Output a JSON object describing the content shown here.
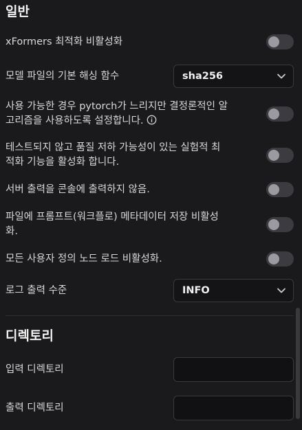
{
  "general": {
    "title": "일반",
    "xformers_label": "xFormers 최적화 비활성화",
    "hash_label": "모델 파일의 기본 해싱 함수",
    "hash_value": "sha256",
    "deterministic_label_1": "사용 가능한 경우 pytorch가 느리지만 결정론적인 알",
    "deterministic_label_2": "고리즘을 사용하도록 설정합니다.",
    "experimental_label_1": "테스트되지 않고 품질 저하 가능성이 있는 실험적 최",
    "experimental_label_2": "적화 기능을 활성화 합니다.",
    "console_label": "서버 출력을 콘솔에 출력하지 않음.",
    "metadata_label_1": "파일에 프롬프트(워크플로) 메타데이터 저장 비활성",
    "metadata_label_2": "화.",
    "custom_nodes_label": "모든 사용자 정의 노드 로드 비활성화.",
    "log_label": "로그 출력 수준",
    "log_value": "INFO"
  },
  "directory": {
    "title": "디렉토리",
    "input_label": "입력 디렉토리",
    "output_label": "출력 디렉토리"
  },
  "icons": [
    "chevron-down-icon",
    "info-icon"
  ]
}
